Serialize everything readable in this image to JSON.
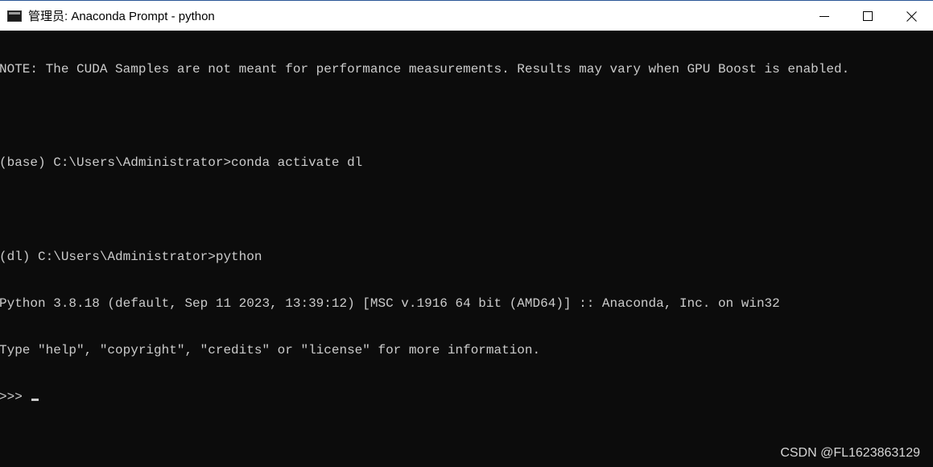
{
  "window": {
    "title": "管理员: Anaconda Prompt - python",
    "icon": "console-icon",
    "controls": {
      "minimize": "—",
      "maximize": "□",
      "close": "✕"
    }
  },
  "console": {
    "lines": [
      "NOTE: The CUDA Samples are not meant for performance measurements. Results may vary when GPU Boost is enabled.",
      "",
      "(base) C:\\Users\\Administrator>conda activate dl",
      "",
      "(dl) C:\\Users\\Administrator>python",
      "Python 3.8.18 (default, Sep 11 2023, 13:39:12) [MSC v.1916 64 bit (AMD64)] :: Anaconda, Inc. on win32",
      "Type \"help\", \"copyright\", \"credits\" or \"license\" for more information."
    ],
    "prompt": ">>> "
  },
  "watermark": "CSDN @FL1623863129",
  "colors": {
    "background": "#0c0c0c",
    "text": "#cccccc",
    "titlebar": "#ffffff"
  }
}
